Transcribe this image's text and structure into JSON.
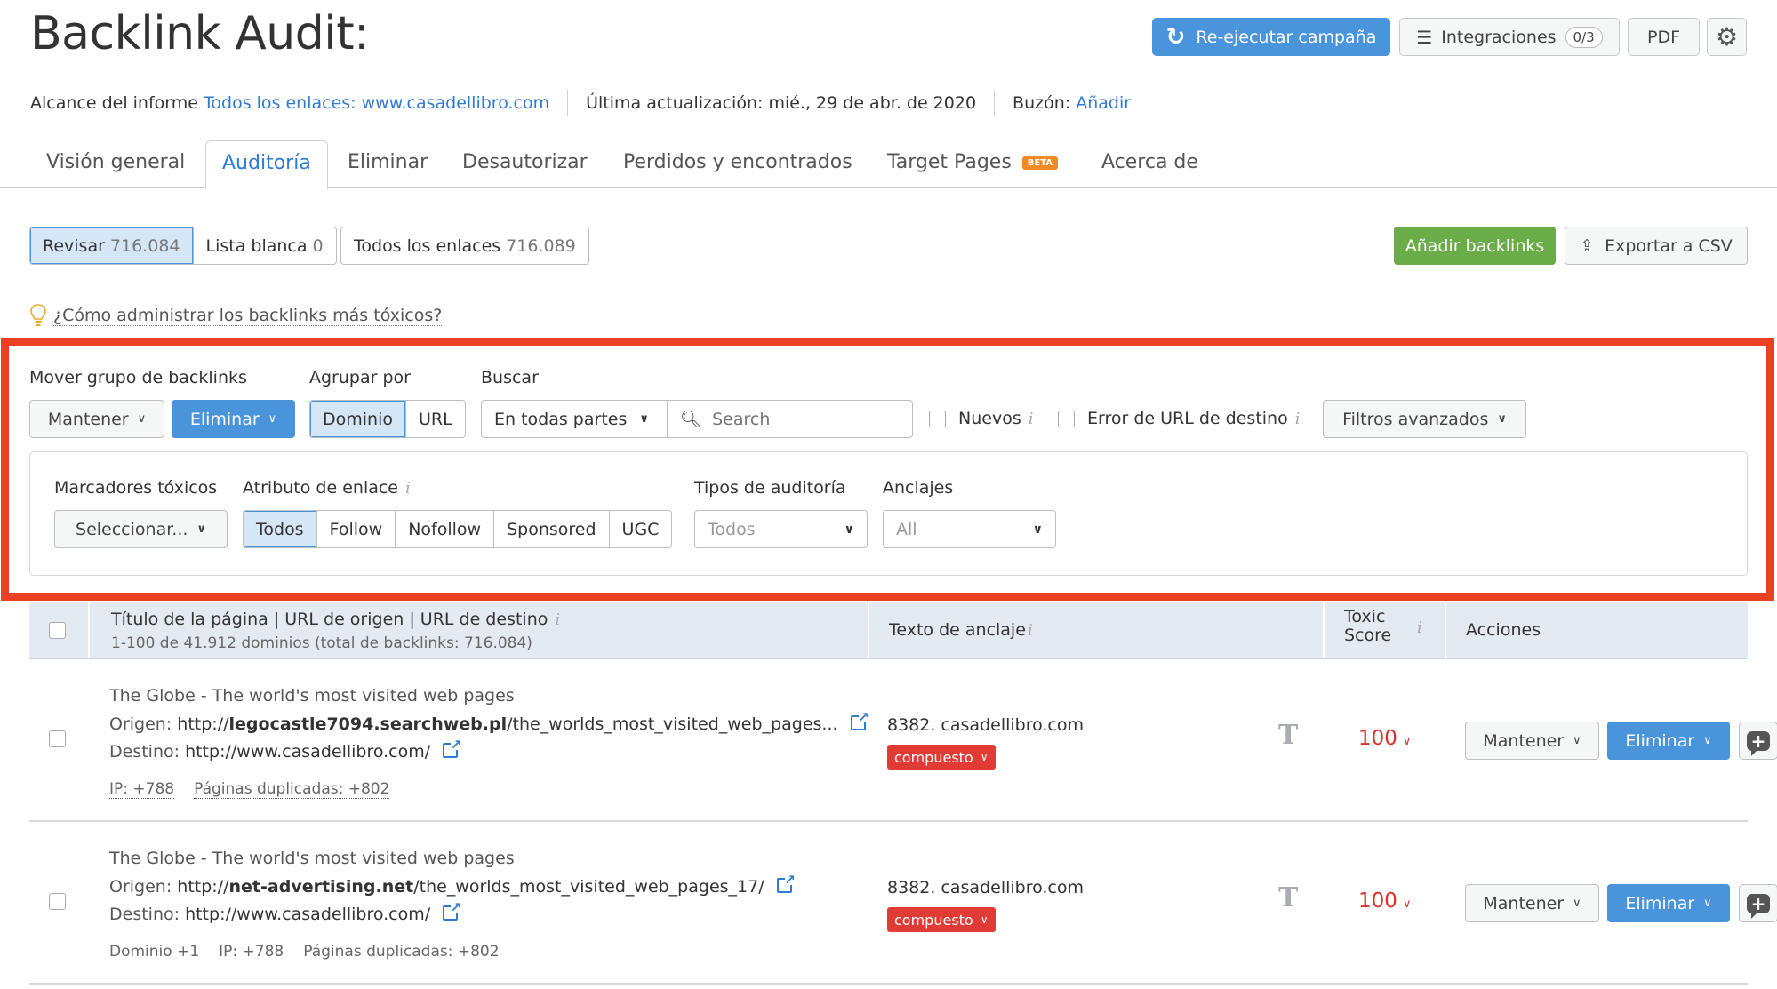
{
  "header": {
    "title": "Backlink Audit:",
    "rerun_label": "Re-ejecutar campaña",
    "integrations_label": "Integraciones",
    "integrations_count": "0/3",
    "pdf_label": "PDF"
  },
  "meta": {
    "scope_label": "Alcance del informe",
    "scope_value": "Todos los enlaces: www.casadellibro.com",
    "updated": "Última actualización: mié., 29 de abr. de 2020",
    "mailbox_label": "Buzón:",
    "mailbox_link": "Añadir"
  },
  "tabs": [
    {
      "label": "Visión general"
    },
    {
      "label": "Auditoría",
      "active": true
    },
    {
      "label": "Eliminar"
    },
    {
      "label": "Desautorizar"
    },
    {
      "label": "Perdidos y encontrados"
    },
    {
      "label": "Target Pages",
      "badge": "BETA"
    },
    {
      "label": "Acerca de"
    }
  ],
  "views": {
    "review_label": "Revisar",
    "review_count": "716.084",
    "whitelist_label": "Lista blanca",
    "whitelist_count": "0",
    "all_label": "Todos los enlaces",
    "all_count": "716.089",
    "add_backlinks": "Añadir backlinks",
    "export_csv": "Exportar a CSV"
  },
  "tip": "¿Cómo administrar los backlinks más tóxicos?",
  "filters": {
    "move_group_label": "Mover grupo de backlinks",
    "keep": "Mantener",
    "remove": "Eliminar",
    "group_by_label": "Agrupar por",
    "group_domain": "Dominio",
    "group_url": "URL",
    "search_label": "Buscar",
    "search_scope": "En todas partes",
    "search_placeholder": "Search",
    "new_label": "Nuevos",
    "target_error_label": "Error de URL de destino",
    "advanced": "Filtros avanzados",
    "toxic_markers_label": "Marcadores tóxicos",
    "toxic_markers_value": "Seleccionar...",
    "link_attr_label": "Atributo de enlace",
    "link_attrs": [
      "Todos",
      "Follow",
      "Nofollow",
      "Sponsored",
      "UGC"
    ],
    "audit_types_label": "Tipos de auditoría",
    "audit_types_value": "Todos",
    "anchors_label": "Anclajes",
    "anchors_value": "All"
  },
  "table": {
    "col_title": "Título de la página | URL de origen | URL de destino",
    "col_title_sub": "1-100 de 41.912 dominios (total de backlinks: 716.084)",
    "col_anchor": "Texto de anclaje",
    "col_toxic_1": "Toxic",
    "col_toxic_2": "Score",
    "col_actions": "Acciones",
    "rows": [
      {
        "title": "The Globe - The world's most visited web pages",
        "source_label": "Origen:",
        "source_prefix": "http://",
        "source_domain": "legocastle7094.searchweb.pl",
        "source_path": "/the_worlds_most_visited_web_pages...",
        "target_label": "Destino:",
        "target": "http://www.casadellibro.com/",
        "tags": [
          "IP: +788",
          "Páginas duplicadas: +802"
        ],
        "anchor": "8382. casadellibro.com",
        "anchor_tag": "compuesto",
        "score": "100",
        "keep": "Mantener",
        "remove": "Eliminar"
      },
      {
        "title": "The Globe - The world's most visited web pages",
        "source_label": "Origen:",
        "source_prefix": "http://",
        "source_domain": "net-advertising.net",
        "source_path": "/the_worlds_most_visited_web_pages_17/",
        "target_label": "Destino:",
        "target": "http://www.casadellibro.com/",
        "tags": [
          "Dominio +1",
          "IP: +788",
          "Páginas duplicadas: +802"
        ],
        "anchor": "8382. casadellibro.com",
        "anchor_tag": "compuesto",
        "score": "100",
        "keep": "Mantener",
        "remove": "Eliminar"
      }
    ]
  },
  "colors": {
    "accent_blue": "#4a94dc",
    "link_blue": "#2d7bd2",
    "green": "#6aac47",
    "toxic_red": "#d9302b",
    "highlight_red": "#ea4126"
  }
}
